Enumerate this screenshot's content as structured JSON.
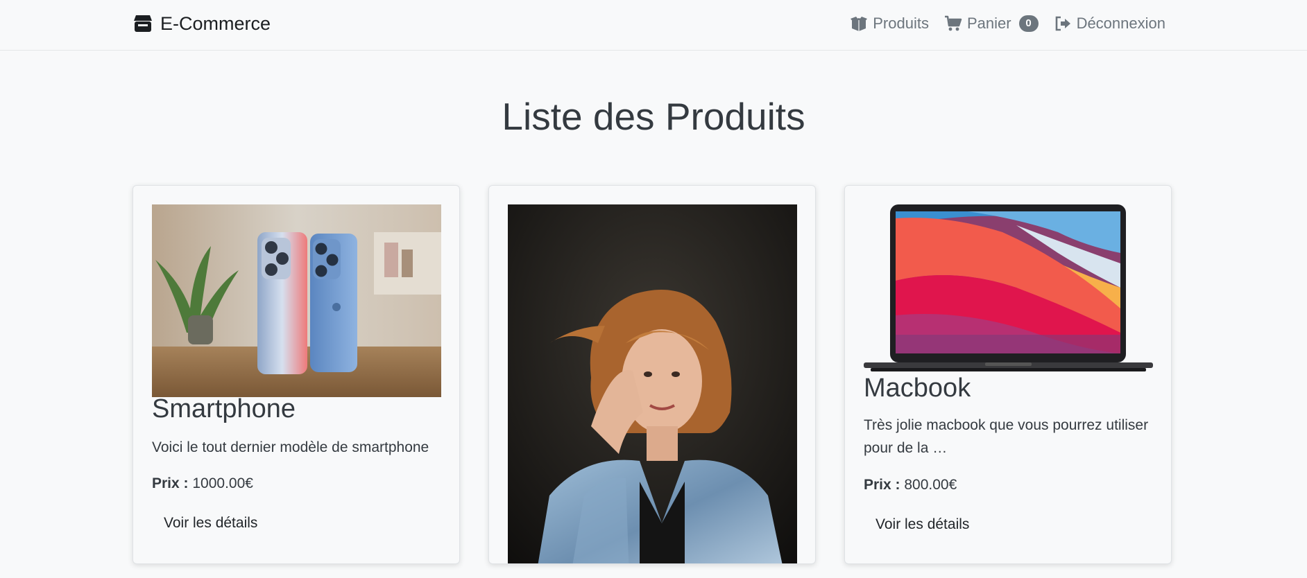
{
  "navbar": {
    "brand": "E-Commerce",
    "links": [
      {
        "label": "Produits",
        "icon": "box-open-icon"
      },
      {
        "label": "Panier",
        "icon": "cart-icon",
        "badge": "0"
      },
      {
        "label": "Déconnexion",
        "icon": "sign-out-icon"
      }
    ]
  },
  "page": {
    "title": "Liste des Produits"
  },
  "products": [
    {
      "name": "Smartphone",
      "description": "Voici le tout dernier modèle de smartphone",
      "price_label": "Prix :",
      "price": "1000.00€",
      "button": "Voir les détails",
      "image": "smartphone-photo"
    },
    {
      "name": "",
      "description": "",
      "price_label": "",
      "price": "",
      "button": "",
      "image": "woman-portrait-photo"
    },
    {
      "name": "Macbook",
      "description": "Très jolie macbook que vous pourrez utiliser pour de la …",
      "price_label": "Prix :",
      "price": "800.00€",
      "button": "Voir les détails",
      "image": "macbook-photo"
    }
  ],
  "colors": {
    "badge": "#6c757d",
    "nav_text": "#6c757d",
    "background": "#f8f9fa"
  }
}
